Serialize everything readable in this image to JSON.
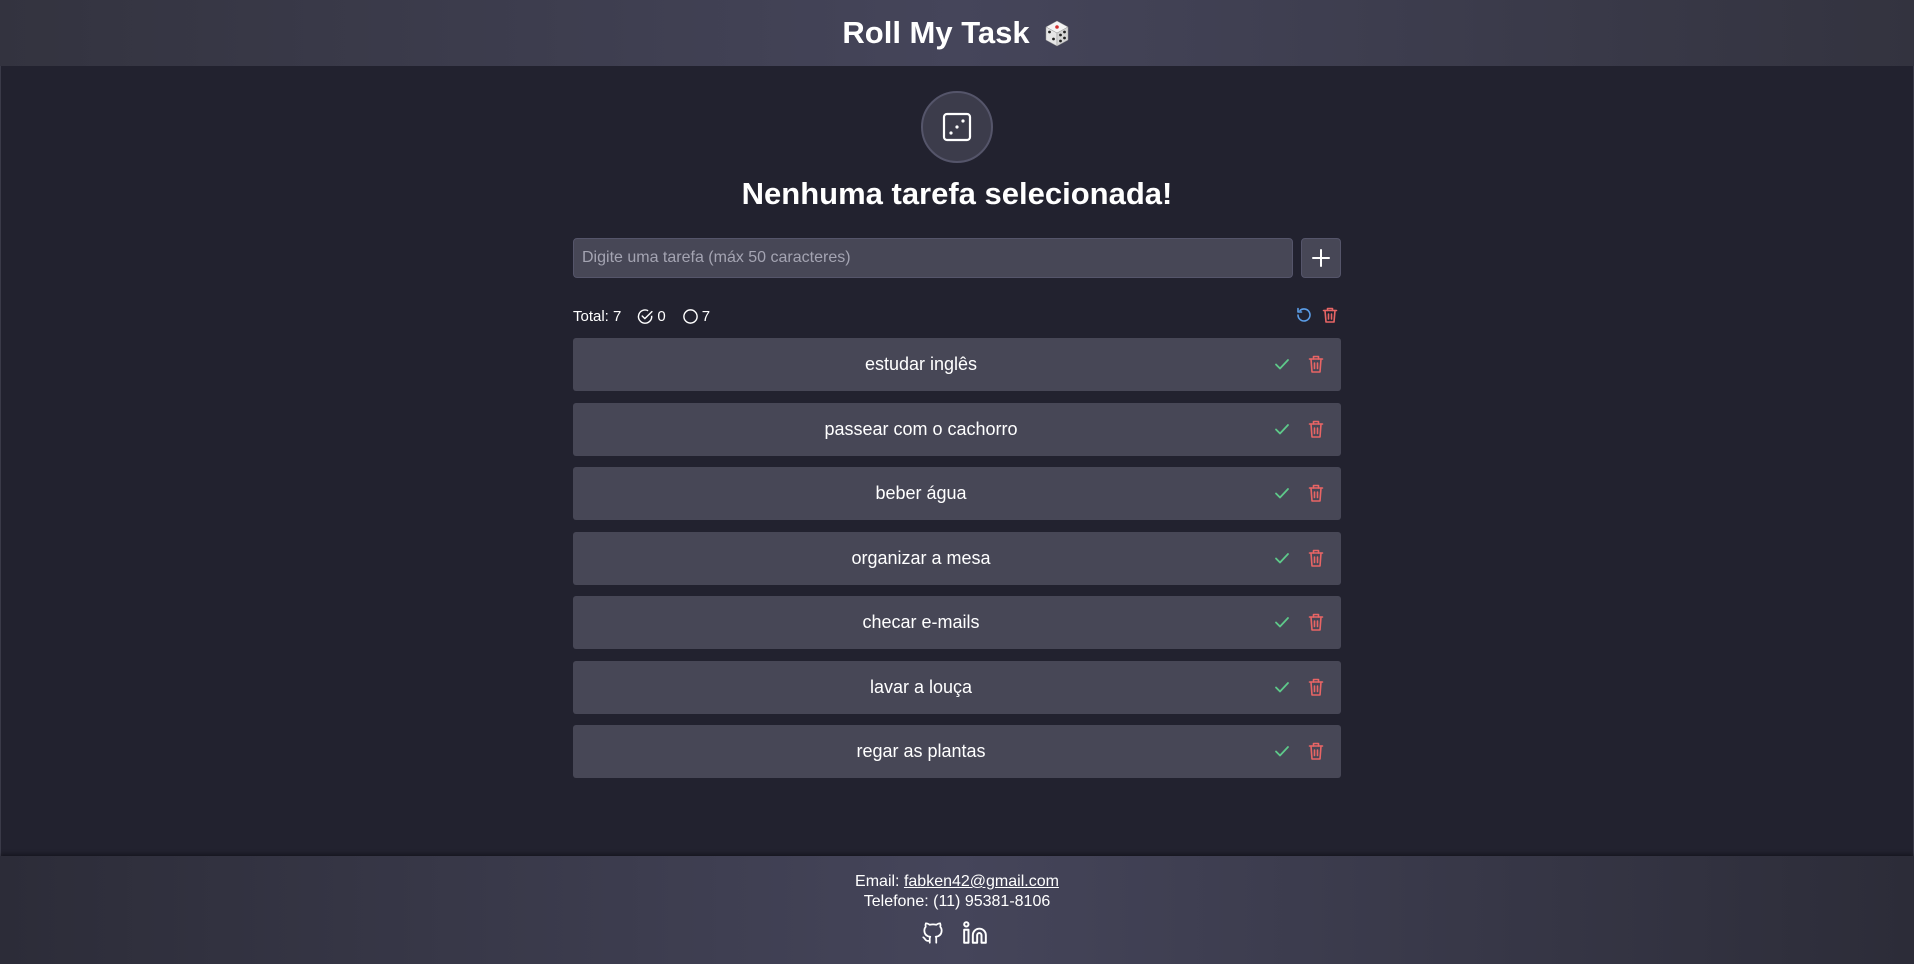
{
  "header": {
    "title": "Roll My Task",
    "logo_icon": "dice-icon"
  },
  "roll_button": {
    "icon": "dice-icon"
  },
  "selected": {
    "text": "Nenhuma tarefa selecionada!"
  },
  "input": {
    "placeholder": "Digite uma tarefa (máx 50 caracteres)",
    "value": "",
    "add_icon": "plus-icon"
  },
  "stats": {
    "total_label": "Total: 7",
    "done_count": "0",
    "pending_count": "7"
  },
  "tasks": [
    {
      "label": "estudar inglês"
    },
    {
      "label": "passear com o cachorro"
    },
    {
      "label": "beber água"
    },
    {
      "label": "organizar a mesa"
    },
    {
      "label": "checar e-mails"
    },
    {
      "label": "lavar a louça"
    },
    {
      "label": "regar as plantas"
    }
  ],
  "footer": {
    "email_prefix": "Email: ",
    "email": "fabken42@gmail.com",
    "phone": "Telefone: (11) 95381-8106",
    "social_icons": [
      "github-icon",
      "linkedin-icon"
    ]
  },
  "colors": {
    "background": "#22222f",
    "card": "#474756",
    "check": "#5ec98a",
    "delete": "#e86565",
    "reset": "#5b9ee8"
  }
}
